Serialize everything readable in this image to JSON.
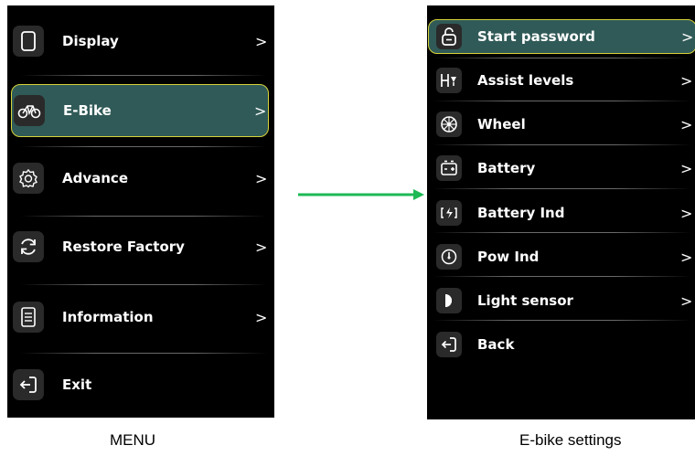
{
  "menu": {
    "caption": "MENU",
    "items": [
      {
        "label": "Display",
        "chevron": ">",
        "icon": "display-icon"
      },
      {
        "label": "E-Bike",
        "chevron": ">",
        "icon": "bicycle-icon",
        "selected": true
      },
      {
        "label": "Advance",
        "chevron": ">",
        "icon": "gear-icon"
      },
      {
        "label": "Restore Factory",
        "chevron": ">",
        "icon": "restore-icon"
      },
      {
        "label": "Information",
        "chevron": ">",
        "icon": "document-icon"
      },
      {
        "label": "Exit",
        "icon": "exit-icon"
      }
    ]
  },
  "ebike_settings": {
    "caption": "E-bike settings",
    "items": [
      {
        "label": "Start password",
        "chevron": ">",
        "icon": "lock-icon",
        "selected": true
      },
      {
        "label": "Assist levels",
        "chevron": ">",
        "icon": "assist-icon"
      },
      {
        "label": "Wheel",
        "chevron": ">",
        "icon": "wheel-icon"
      },
      {
        "label": "Battery",
        "chevron": ">",
        "icon": "battery-icon"
      },
      {
        "label": "Battery Ind",
        "chevron": ">",
        "icon": "battery-charge-icon"
      },
      {
        "label": "Pow Ind",
        "chevron": ">",
        "icon": "power-gauge-icon"
      },
      {
        "label": "Light sensor",
        "chevron": ">",
        "icon": "light-sensor-icon"
      },
      {
        "label": "Back",
        "icon": "back-icon"
      }
    ]
  },
  "colors": {
    "screen_bg": "#000000",
    "selected_bg": "#305a57",
    "selected_border": "#d6d23a",
    "arrow": "#1db954"
  }
}
